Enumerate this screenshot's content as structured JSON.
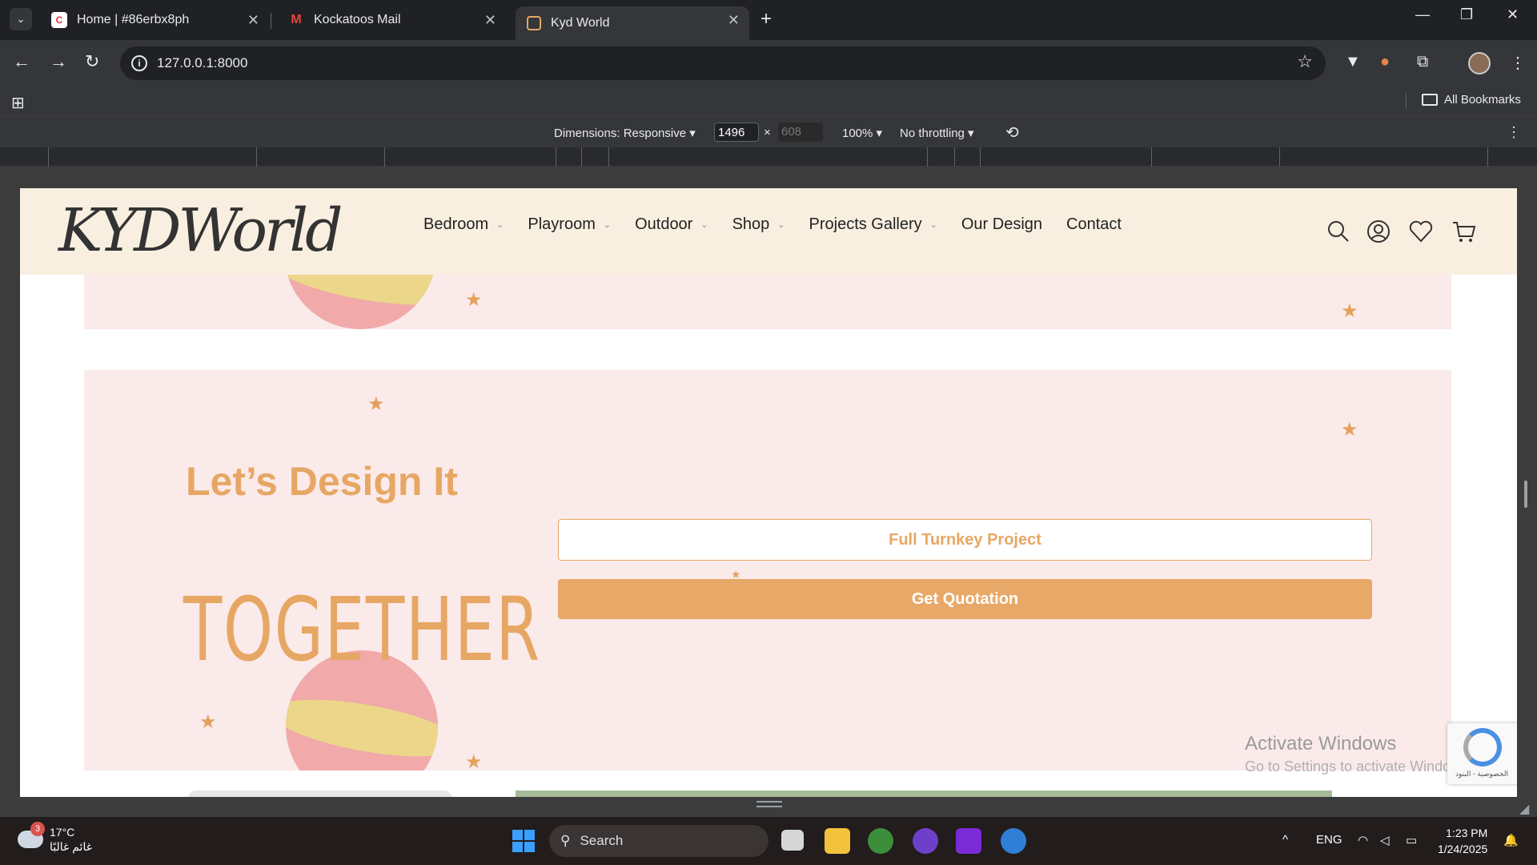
{
  "browser": {
    "tabs": [
      {
        "title": "Home | #86erbx8ph",
        "icon": "clickup-icon"
      },
      {
        "title": "Kockatoos Mail",
        "icon": "gmail-icon"
      },
      {
        "title": "Kyd World",
        "icon": "site-icon",
        "active": true
      }
    ],
    "url": "127.0.0.1:8000",
    "bookmarks_label": "All Bookmarks"
  },
  "devtools": {
    "dimensions_label": "Dimensions: Responsive",
    "width": "1496",
    "height_placeholder": "608",
    "times": "×",
    "zoom": "100%",
    "throttling": "No throttling"
  },
  "site": {
    "logo": "KYDWorld",
    "nav": [
      {
        "label": "Bedroom",
        "dropdown": true
      },
      {
        "label": "Playroom",
        "dropdown": true
      },
      {
        "label": "Outdoor",
        "dropdown": true
      },
      {
        "label": "Shop",
        "dropdown": true
      },
      {
        "label": "Projects Gallery",
        "dropdown": true
      },
      {
        "label": "Our Design",
        "dropdown": false
      },
      {
        "label": "Contact",
        "dropdown": false
      }
    ],
    "hero": {
      "line1": "Let’s Design It",
      "line2": "TOGETHER",
      "btn_outline": "Full Turnkey Project",
      "btn_solid": "Get Quotation"
    },
    "colors": {
      "header_bg": "#f9efe0",
      "band_bg": "#fbeaea",
      "accent": "#e7a764"
    }
  },
  "watermark": {
    "title": "Activate Windows",
    "subtitle": "Go to Settings to activate Windows."
  },
  "recaptcha": {
    "text": "الخصوصية - البنود"
  },
  "taskbar": {
    "weather_temp": "17°C",
    "weather_desc": "غائم غالبًا",
    "weather_badge": "3",
    "search_label": "Search",
    "lang": "ENG",
    "time": "1:23 PM",
    "date": "1/24/2025"
  }
}
